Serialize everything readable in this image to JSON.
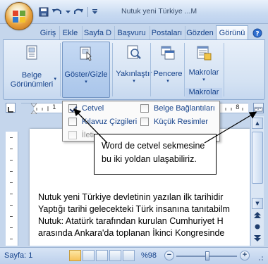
{
  "window": {
    "title": "Nutuk yeni Türkiye ...M"
  },
  "tabs": [
    {
      "label": "Giriş"
    },
    {
      "label": "Ekle"
    },
    {
      "label": "Sayfa D"
    },
    {
      "label": "Başvuru"
    },
    {
      "label": "Postaları"
    },
    {
      "label": "Gözden"
    },
    {
      "label": "Görünü",
      "active": true
    }
  ],
  "ribbon": {
    "belge_gorunumleri": {
      "line1": "Belge",
      "line2": "Görünümleri",
      "icon": "document-views-icon"
    },
    "goster_gizle": {
      "label": "Göster/Gizle",
      "icon": "show-hide-icon",
      "pressed": true
    },
    "yakinlastir": {
      "label": "Yakınlaştır",
      "icon": "zoom-icon"
    },
    "pencere": {
      "label": "Pencere",
      "icon": "window-icon"
    },
    "makrolar": {
      "label": "Makrolar",
      "icon": "macros-icon"
    },
    "makrolar_group": "Makrolar"
  },
  "ruler": {
    "numbers": [
      "1",
      "8"
    ]
  },
  "dropdown": {
    "items": [
      {
        "label": "Cetvel",
        "checked": true,
        "enabled": true
      },
      {
        "label": "Belge Bağlantıları",
        "checked": false,
        "enabled": true
      },
      {
        "label": "Kılavuz Çizgileri",
        "checked": false,
        "enabled": true
      },
      {
        "label": "Küçük Resimler",
        "checked": false,
        "enabled": true
      },
      {
        "label": "İleti",
        "checked": false,
        "enabled": false
      }
    ]
  },
  "callout": {
    "line1": "Word de cetvel sekmesine",
    "line2": "bu iki yoldan ulaşabiliriz."
  },
  "document": {
    "lines": [
      "Nutuk yeni Türkiye devletinin yazılan ilk tarihidir",
      "Yaptığı tarihi gelecekteki Türk insanına tanıtabilm",
      "Nutuk: Atatürk tarafından kurulan Cumhuriyet H",
      "arasında Ankara'da toplanan İkinci Kongresinde"
    ]
  },
  "status_bar": {
    "page": "Sayfa: 1",
    "zoom": "%98"
  },
  "colors": {
    "ribbon_text": "#15428b",
    "accent_orange": "#e8a33d",
    "chrome_blue": "#c5d6ec"
  }
}
